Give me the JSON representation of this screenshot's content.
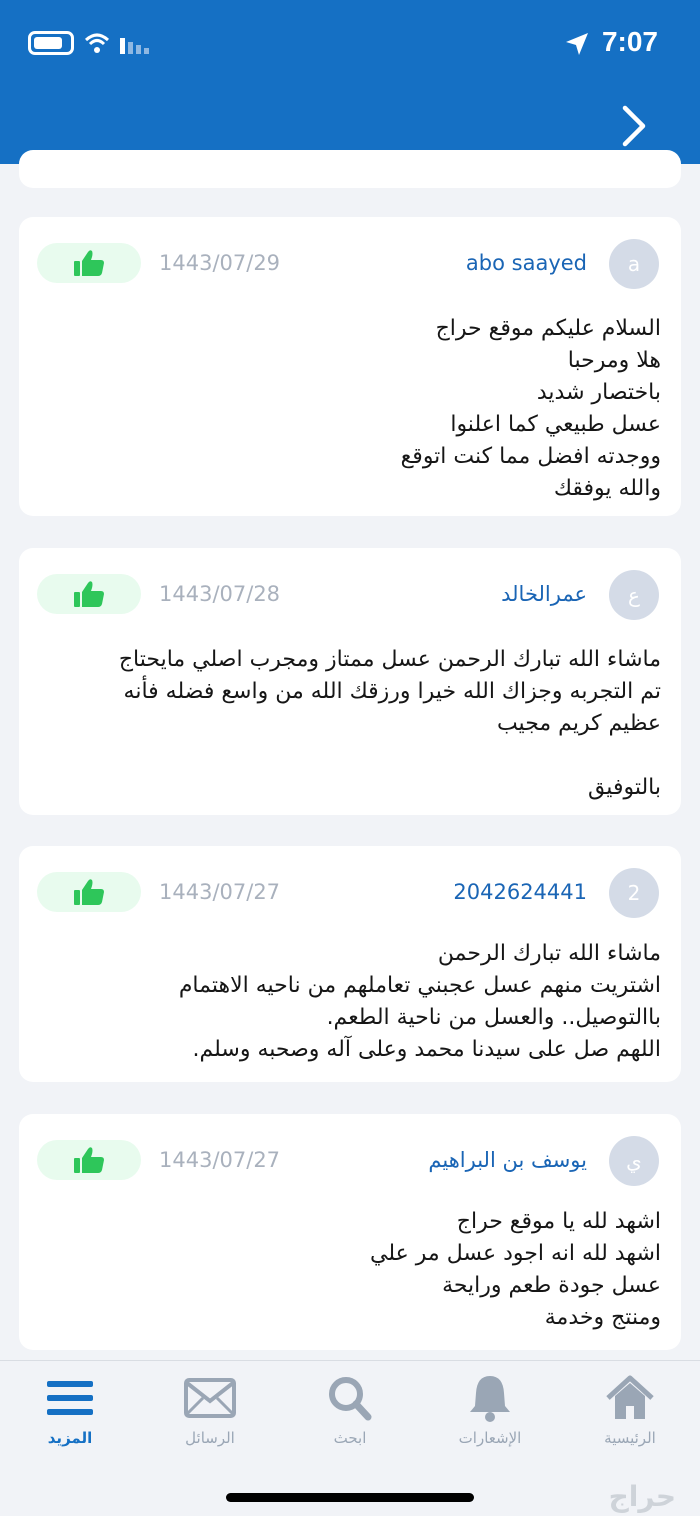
{
  "status_bar": {
    "time": "7:07"
  },
  "colors": {
    "header": "#1570c4",
    "username": "#1a65b5",
    "like_bg": "#e8fbee",
    "like_icon": "#2ec65a",
    "tab_active": "#1570c4",
    "tab_inactive": "#9aa6b5"
  },
  "reviews": [
    {
      "avatar": "a",
      "user": "abo saayed",
      "date": "1443/07/29",
      "text": "السلام عليكم موقع حراج\nهلا ومرحبا\nباختصار شديد\nعسل طبيعي كما اعلنوا\nووجدته افضل مما كنت اتوقع\nوالله يوفقك"
    },
    {
      "avatar": "ع",
      "user": "عمرالخالد",
      "date": "1443/07/28",
      "text": "ماشاء الله تبارك الرحمن عسل ممتاز ومجرب اصلي مايحتاج\nتم التجربه وجزاك الله خيرا ورزقك الله من واسع فضله فأنه\nعظيم كريم مجيب\n\nبالتوفيق"
    },
    {
      "avatar": "2",
      "user": "2042624441",
      "date": "1443/07/27",
      "text": "ماشاء الله تبارك الرحمن\nاشتريت منهم عسل عجبني تعاملهم من ناحيه الاهتمام\nباالتوصيل.. والعسل من ناحية الطعم.\nاللهم صل على سيدنا محمد وعلى آله وصحبه وسلم."
    },
    {
      "avatar": "ي",
      "user": "يوسف بن البراهيم",
      "date": "1443/07/27",
      "text": "اشهد لله يا موقع حراج\nاشهد لله انه اجود عسل مر علي\nعسل جودة طعم ورايحة\nومنتج وخدمة"
    }
  ],
  "tabs": [
    {
      "label": "الرئيسية",
      "icon": "home-icon"
    },
    {
      "label": "الإشعارات",
      "icon": "bell-icon"
    },
    {
      "label": "ابحث",
      "icon": "search-icon"
    },
    {
      "label": "الرسائل",
      "icon": "mail-icon"
    },
    {
      "label": "المزيد",
      "icon": "menu-icon"
    }
  ],
  "watermark": "حراج"
}
